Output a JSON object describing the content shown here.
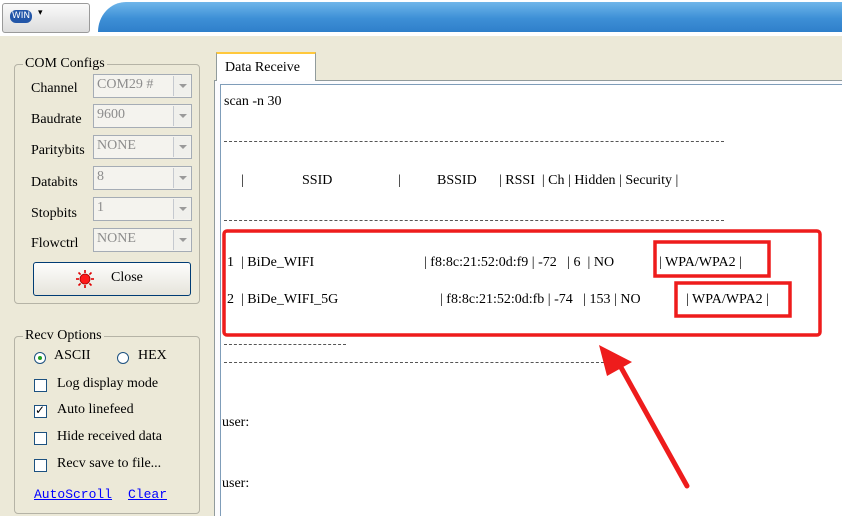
{
  "toolbar": {
    "logo": "WIN",
    "chevron": "▾"
  },
  "com_configs": {
    "title": "COM Configs",
    "channel": {
      "label": "Channel",
      "value": "COM29 #"
    },
    "baudrate": {
      "label": "Baudrate",
      "value": "9600"
    },
    "paritybits": {
      "label": "Paritybits",
      "value": "NONE"
    },
    "databits": {
      "label": "Databits",
      "value": "8"
    },
    "stopbits": {
      "label": "Stopbits",
      "value": "1"
    },
    "flowctrl": {
      "label": "Flowctrl",
      "value": "NONE"
    },
    "close_button": "Close"
  },
  "recv_options": {
    "title": "Recv Options",
    "ascii": "ASCII",
    "hex": "HEX",
    "selected": "ASCII",
    "log_display_mode": {
      "label": "Log display mode",
      "checked": false
    },
    "auto_linefeed": {
      "label": "Auto linefeed",
      "checked": true
    },
    "hide_received_data": {
      "label": "Hide received data",
      "checked": false
    },
    "recv_save_to_file": {
      "label": "Recv save to file...",
      "checked": false
    },
    "autoscroll": "AutoScroll",
    "clear": "Clear"
  },
  "data_receive": {
    "tab_label": "Data Receive",
    "command": "scan -n 30",
    "header": {
      "sep1": "|",
      "ssid": "SSID",
      "sep2": "|",
      "bssid": "BSSID",
      "rest": "| RSSI  | Ch | Hidden | Security |"
    },
    "rows": [
      {
        "prefix": "1  | BiDe_WIFI",
        "mid": "| f8:8c:21:52:0d:f9 | -72   | 6  | NO",
        "security": "| WPA/WPA2 |"
      },
      {
        "prefix": "2  | BiDe_WIFI_5G",
        "mid": "| f8:8c:21:52:0d:fb | -74   | 153 | NO",
        "security": "| WPA/WPA2 |"
      }
    ],
    "user1": "user:",
    "user2": "user:"
  },
  "colors": {
    "highlight": "#ee1c1c",
    "title_bar": "#3d8fd6",
    "link": "#0000ff"
  }
}
